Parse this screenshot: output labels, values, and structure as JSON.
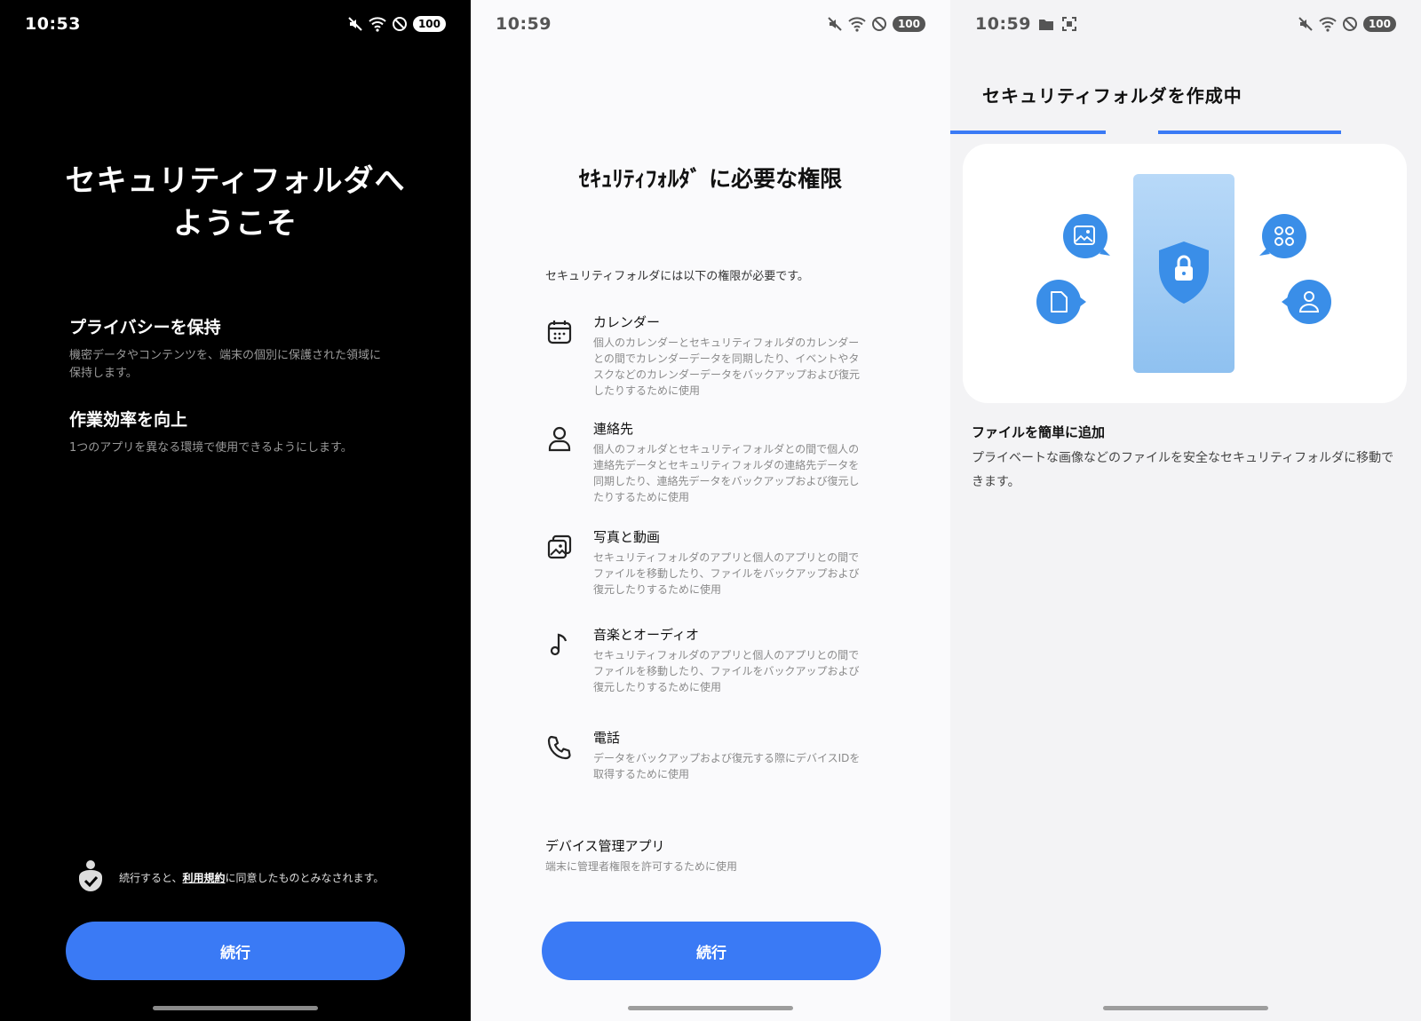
{
  "colors": {
    "accent": "#3a7af5",
    "illustration_blue": "#3a8ee8",
    "phone_blue": "#a9d0f5"
  },
  "screen1": {
    "status": {
      "time": "10:53",
      "battery": "100"
    },
    "title_line1": "セキュリティフォルダへ",
    "title_line2": "ようこそ",
    "features": [
      {
        "title": "プライバシーを保持",
        "desc_line1": "機密データやコンテンツを、端末の個別に保護された領域に",
        "desc_line2": "保持します。"
      },
      {
        "title": "作業効率を向上",
        "desc_line1": "1つのアプリを異なる環境で使用できるようにします。"
      }
    ],
    "terms": {
      "prefix": "続行すると、",
      "link": "利用規約",
      "suffix": "に同意したものとみなされます。"
    },
    "continue_label": "続行"
  },
  "screen2": {
    "status": {
      "time": "10:59",
      "battery": "100"
    },
    "title": "ｾｷｭﾘﾃｨﾌｫﾙﾀﾞ に必要な権限",
    "intro": "セキュリティフォルダには以下の権限が必要です。",
    "permissions": [
      {
        "icon": "calendar-icon",
        "title": "カレンダー",
        "desc": [
          "個人のカレンダーとセキュリティフォルダのカレンダー",
          "との間でカレンダーデータを同期したり、イベントやタ",
          "スクなどのカレンダーデータをバックアップおよび復元",
          "したりするために使用"
        ]
      },
      {
        "icon": "person-icon",
        "title": "連絡先",
        "desc": [
          "個人のフォルダとセキュリティフォルダとの間で個人の",
          "連絡先データとセキュリティフォルダの連絡先データを",
          "同期したり、連絡先データをバックアップおよび復元し",
          "たりするために使用"
        ]
      },
      {
        "icon": "photos-icon",
        "title": "写真と動画",
        "desc": [
          "セキュリティフォルダのアプリと個人のアプリとの間で",
          "ファイルを移動したり、ファイルをバックアップおよび",
          "復元したりするために使用"
        ]
      },
      {
        "icon": "music-note-icon",
        "title": "音楽とオーディオ",
        "desc": [
          "セキュリティフォルダのアプリと個人のアプリとの間で",
          "ファイルを移動したり、ファイルをバックアップおよび",
          "復元したりするために使用"
        ]
      },
      {
        "icon": "phone-icon",
        "title": "電話",
        "desc": [
          "データをバックアップおよび復元する際にデバイスIDを",
          "取得するために使用"
        ]
      }
    ],
    "admin": {
      "title": "デバイス管理アプリ",
      "desc": "端末に管理者権限を許可するために使用"
    },
    "continue_label": "続行"
  },
  "screen3": {
    "status": {
      "time": "10:59",
      "battery": "100"
    },
    "title": "セキュリティフォルダを作成中",
    "progress": {
      "steps": 2,
      "completed": 2
    },
    "heading": "ファイルを簡単に追加",
    "desc": "プライベートな画像などのファイルを安全なセキュリティフォルダに移動できます。"
  }
}
